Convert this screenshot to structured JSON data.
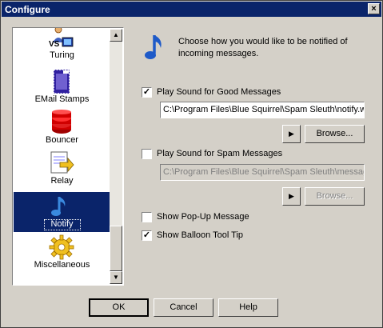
{
  "window": {
    "title": "Configure",
    "close_label": "×"
  },
  "sidebar": {
    "items": [
      {
        "label": "Turing",
        "icon": "turing-icon"
      },
      {
        "label": "EMail Stamps",
        "icon": "stamp-icon"
      },
      {
        "label": "Bouncer",
        "icon": "bouncer-icon"
      },
      {
        "label": "Relay",
        "icon": "relay-icon"
      },
      {
        "label": "Notify",
        "icon": "notify-icon",
        "selected": true
      },
      {
        "label": "Miscellaneous",
        "icon": "gear-icon"
      }
    ],
    "scroll_up": "▲",
    "scroll_down": "▼"
  },
  "main": {
    "description": "Choose how you would like to be notified of incoming messages.",
    "good": {
      "label": "Play Sound for Good Messages",
      "checked": true,
      "path": "C:\\Program Files\\Blue Squirrel\\Spam Sleuth\\notify.w",
      "play_label": "▶",
      "browse_label": "Browse..."
    },
    "spam": {
      "label": "Play Sound for Spam Messages",
      "checked": false,
      "path": "C:\\Program Files\\Blue Squirrel\\Spam Sleuth\\messag",
      "play_label": "▶",
      "browse_label": "Browse..."
    },
    "popup": {
      "label": "Show Pop-Up Message",
      "checked": false
    },
    "balloon": {
      "label": "Show Balloon Tool Tip",
      "checked": true
    },
    "check_mark": "✓"
  },
  "footer": {
    "ok": "OK",
    "cancel": "Cancel",
    "help": "Help"
  },
  "colors": {
    "titlebar": "#0a246a",
    "selection": "#0a246a",
    "dialog": "#d4d0c8"
  },
  "visible_text": {
    "turing_icon_text": "VS"
  }
}
